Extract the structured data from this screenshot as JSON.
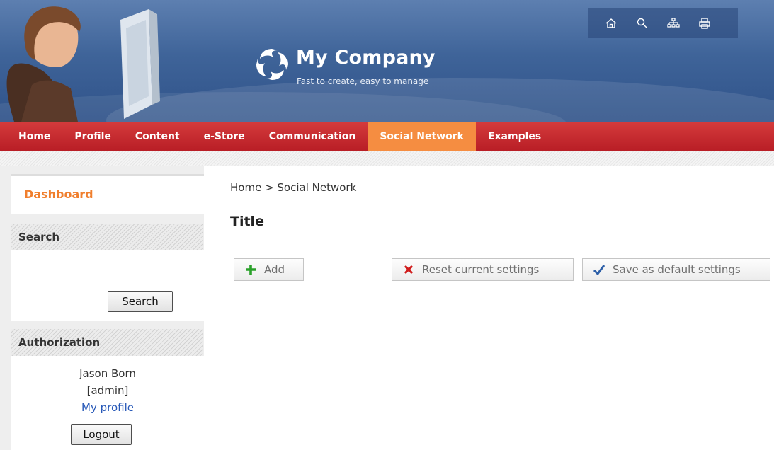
{
  "header": {
    "logo_title": "My Company",
    "logo_tagline": "Fast to create, easy to manage",
    "tools": [
      "home-icon",
      "search-icon",
      "sitemap-icon",
      "print-icon"
    ]
  },
  "nav": {
    "items": [
      "Home",
      "Profile",
      "Content",
      "e-Store",
      "Communication",
      "Social Network",
      "Examples"
    ],
    "active": "Social Network"
  },
  "sidebar": {
    "dashboard_label": "Dashboard",
    "search": {
      "heading": "Search",
      "input_value": "",
      "button_label": "Search"
    },
    "auth": {
      "heading": "Authorization",
      "user_name": "Jason Born",
      "user_role": "[admin]",
      "profile_link": "My profile",
      "logout_label": "Logout"
    }
  },
  "main": {
    "breadcrumb": "Home > Social Network",
    "title": "Title",
    "actions": {
      "add_label": "Add",
      "reset_label": "Reset current settings",
      "save_label": "Save as default settings"
    }
  },
  "colors": {
    "nav_red": "#c0262d",
    "nav_active": "#f58d41",
    "accent_orange": "#f07f2e",
    "link_blue": "#2859b8",
    "header_blue": "#3f6499",
    "add_green": "#2aa12a",
    "reset_red": "#d01c1c",
    "save_blue": "#2d5fa8"
  }
}
